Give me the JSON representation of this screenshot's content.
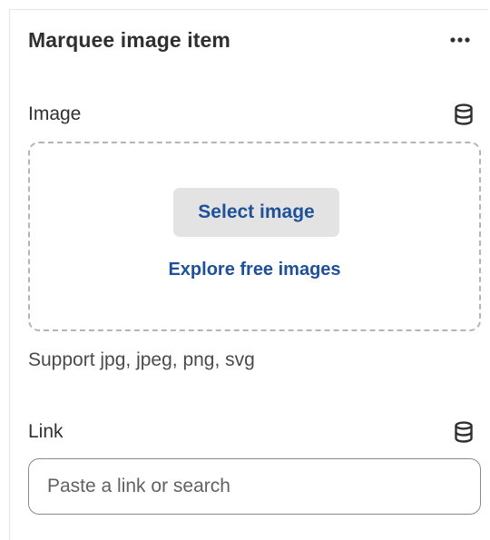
{
  "panel": {
    "title": "Marquee image item",
    "more_icon": "more-horizontal-icon"
  },
  "image_field": {
    "label": "Image",
    "dynamic_source_icon": "database-icon",
    "select_button": "Select image",
    "explore_link": "Explore free images",
    "support_text": "Support jpg, jpeg, png, svg"
  },
  "link_field": {
    "label": "Link",
    "dynamic_source_icon": "database-icon",
    "placeholder": "Paste a link or search",
    "value": ""
  },
  "colors": {
    "link_blue": "#1f5199",
    "button_gray": "#e3e3e3",
    "text": "#303030"
  }
}
